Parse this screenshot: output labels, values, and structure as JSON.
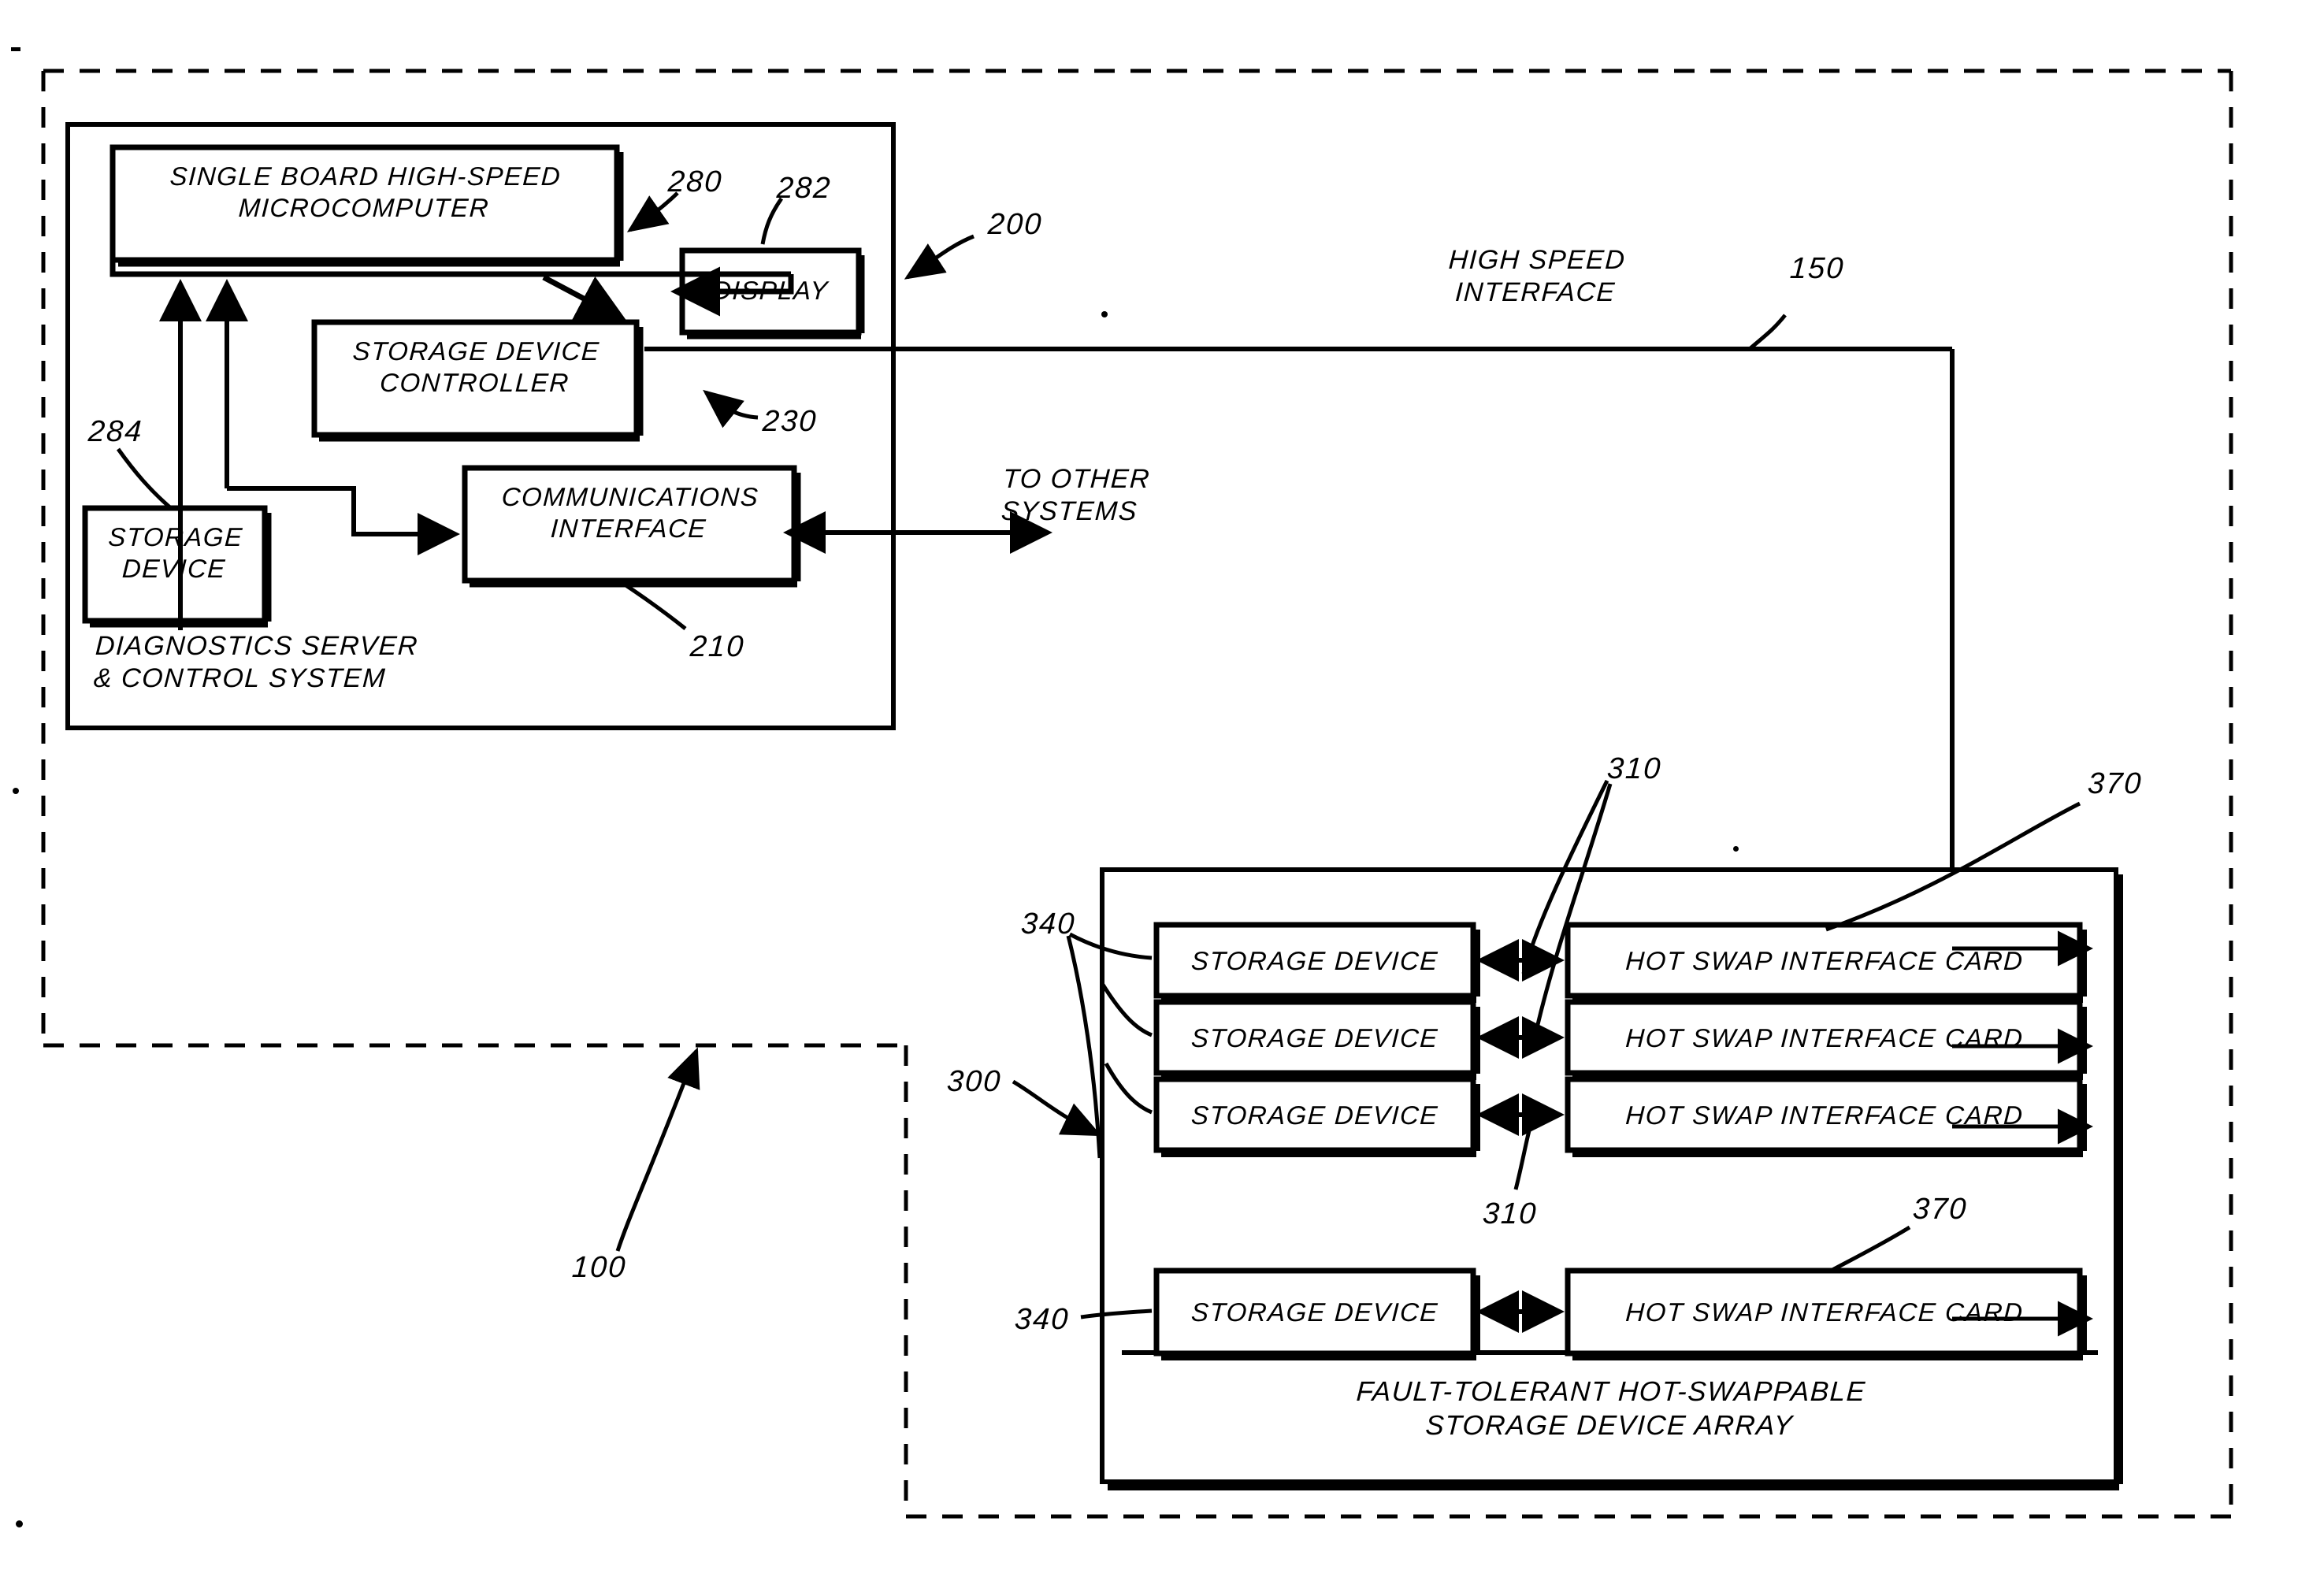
{
  "figure": {
    "type": "patent-block-diagram",
    "background": "#ffffff",
    "ink": "#000000"
  },
  "boxes": {
    "microcomputer": {
      "label": "SINGLE BOARD HIGH-SPEED\nMICROCOMPUTER"
    },
    "display": {
      "label": "DISPLAY"
    },
    "storage_device_controller": {
      "label": "STORAGE DEVICE\nCONTROLLER"
    },
    "communications_interface": {
      "label": "COMMUNICATIONS\nINTERFACE"
    },
    "server_storage_device": {
      "label": "STORAGE\nDEVICE"
    },
    "storage_device_1": {
      "label": "STORAGE DEVICE"
    },
    "storage_device_2": {
      "label": "STORAGE DEVICE"
    },
    "storage_device_3": {
      "label": "STORAGE DEVICE"
    },
    "storage_device_4": {
      "label": "STORAGE DEVICE"
    },
    "hot_swap_card_1": {
      "label": "HOT SWAP INTERFACE CARD"
    },
    "hot_swap_card_2": {
      "label": "HOT SWAP INTERFACE CARD"
    },
    "hot_swap_card_3": {
      "label": "HOT SWAP INTERFACE CARD"
    },
    "hot_swap_card_4": {
      "label": "HOT SWAP INTERFACE CARD"
    }
  },
  "captions": {
    "diagnostics_server": "DIAGNOSTICS SERVER\n& CONTROL SYSTEM",
    "storage_array": "FAULT-TOLERANT HOT-SWAPPABLE\nSTORAGE DEVICE ARRAY",
    "high_speed_interface": "HIGH SPEED\nINTERFACE",
    "to_other_systems": "TO OTHER\nSYSTEMS"
  },
  "reference_numerals": {
    "system": "100",
    "high_speed_interface": "150",
    "diagnostics_server": "200",
    "communications_interface": "210",
    "storage_device_controller": "230",
    "microcomputer": "280",
    "display": "282",
    "server_storage_device": "284",
    "storage_array": "300",
    "device_link_top": "310",
    "device_link_bottom": "310",
    "storage_devices_top": "340",
    "storage_devices_bottom": "340",
    "hot_swap_bus_top": "370",
    "hot_swap_bus_bottom": "370"
  }
}
